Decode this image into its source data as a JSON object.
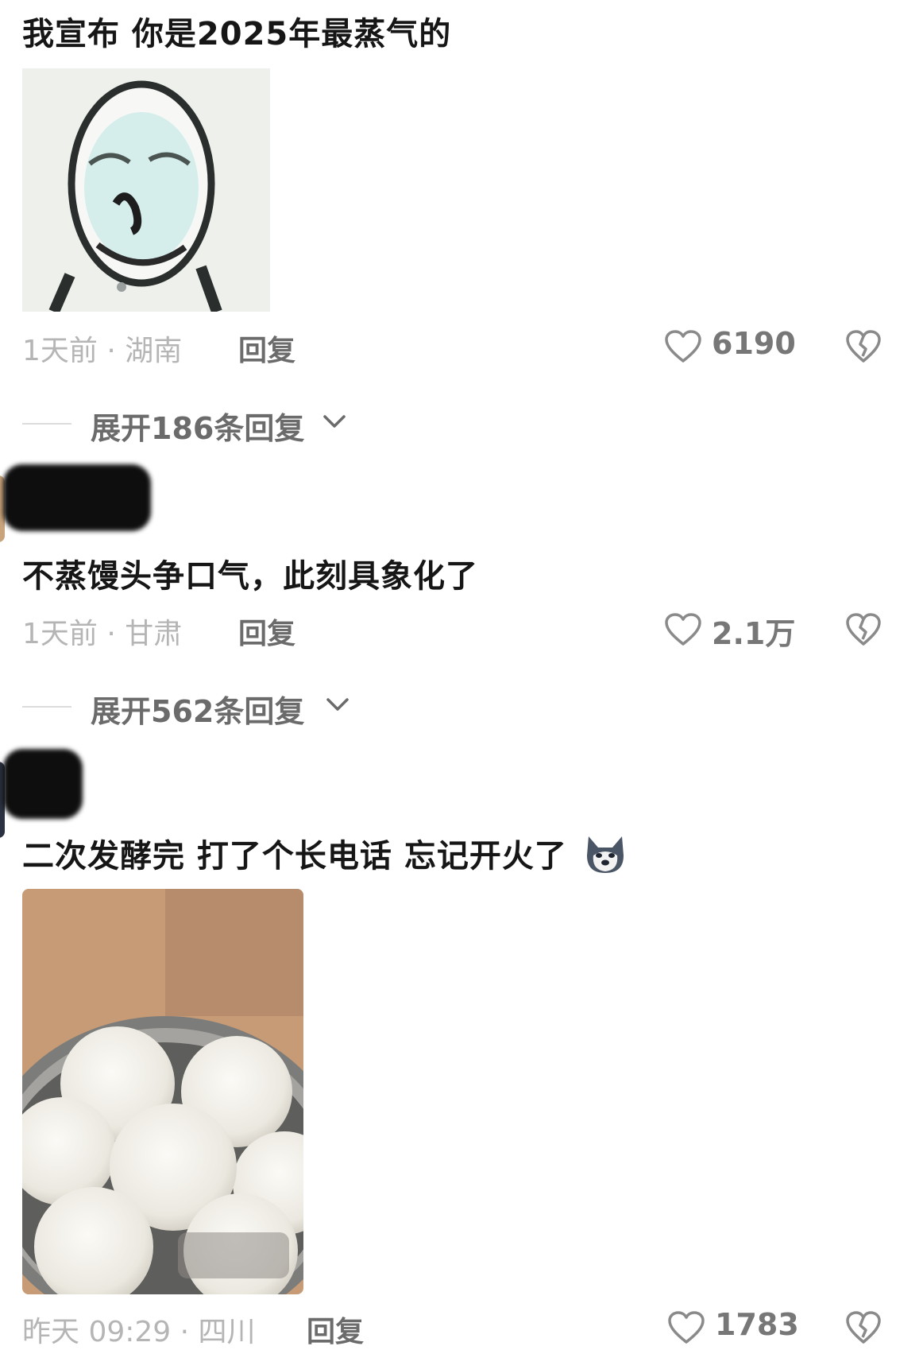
{
  "comments": [
    {
      "text": "我宣布 你是2025年最蒸气的",
      "time_location": "1天前 · 湖南",
      "reply_label": "回复",
      "likes": "6190",
      "expand_label": "展开186条回复"
    },
    {
      "text": "不蒸馒头争口气，此刻具象化了",
      "time_location": "1天前 · 甘肃",
      "reply_label": "回复",
      "likes": "2.1万",
      "expand_label": "展开562条回复"
    },
    {
      "text": "二次发酵完 打了个长电话 忘记开火了",
      "emoji": "husky-dog-emoji",
      "time_location": "昨天 09:29 · 四川",
      "reply_label": "回复",
      "likes": "1783"
    }
  ],
  "icons": [
    "heart-icon",
    "broken-heart-icon",
    "chevron-down-icon"
  ],
  "colors": {
    "meta_gray": "#b5b5b5",
    "action_gray": "#6b6b6b",
    "text": "#161616"
  }
}
